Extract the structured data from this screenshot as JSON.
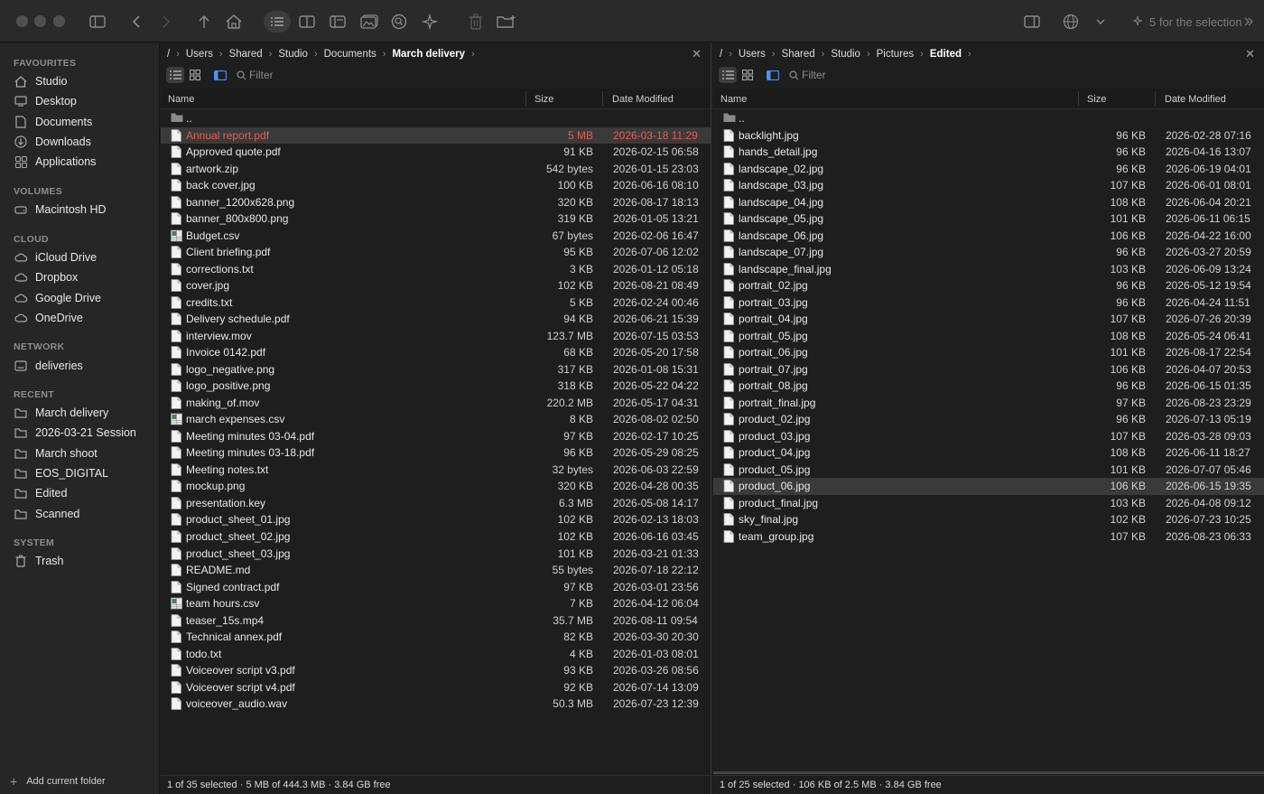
{
  "titlebar": {
    "selection_label": "5 for the selection"
  },
  "sidebar": {
    "favourites_head": "FAVOURITES",
    "favourites": [
      {
        "label": "Studio",
        "icon": "home-icon"
      },
      {
        "label": "Desktop",
        "icon": "desktop-icon"
      },
      {
        "label": "Documents",
        "icon": "document-icon"
      },
      {
        "label": "Downloads",
        "icon": "download-icon"
      },
      {
        "label": "Applications",
        "icon": "apps-icon"
      }
    ],
    "volumes_head": "VOLUMES",
    "volumes": [
      {
        "label": "Macintosh HD",
        "icon": "drive-icon"
      }
    ],
    "cloud_head": "CLOUD",
    "cloud": [
      {
        "label": "iCloud Drive",
        "icon": "cloud-icon"
      },
      {
        "label": "Dropbox",
        "icon": "cloud-icon"
      },
      {
        "label": "Google Drive",
        "icon": "cloud-icon"
      },
      {
        "label": "OneDrive",
        "icon": "cloud-icon"
      }
    ],
    "network_head": "NETWORK",
    "network": [
      {
        "label": "deliveries",
        "icon": "network-drive-icon"
      }
    ],
    "recent_head": "RECENT",
    "recent": [
      {
        "label": "March delivery",
        "icon": "folder-icon"
      },
      {
        "label": "2026-03-21 Session",
        "icon": "folder-icon"
      },
      {
        "label": "March shoot",
        "icon": "folder-icon"
      },
      {
        "label": "EOS_DIGITAL",
        "icon": "folder-icon"
      },
      {
        "label": "Edited",
        "icon": "folder-icon"
      },
      {
        "label": "Scanned",
        "icon": "folder-icon"
      }
    ],
    "system_head": "SYSTEM",
    "system": [
      {
        "label": "Trash",
        "icon": "trash-icon"
      }
    ],
    "add_folder": "Add current folder"
  },
  "left_pane": {
    "breadcrumb": [
      "/",
      "Users",
      "Shared",
      "Studio",
      "Documents",
      "March delivery"
    ],
    "filter_placeholder": "Filter",
    "col_name": "Name",
    "col_size": "Size",
    "col_date": "Date Modified",
    "files": [
      {
        "name": "..",
        "size": "",
        "date": "",
        "type": "folder"
      },
      {
        "name": "Annual report.pdf",
        "size": "5 MB",
        "date": "2026-03-18 11:29",
        "type": "doc",
        "selected": true,
        "highlight": true
      },
      {
        "name": "Approved quote.pdf",
        "size": "91 KB",
        "date": "2026-02-15 06:58",
        "type": "doc"
      },
      {
        "name": "artwork.zip",
        "size": "542 bytes",
        "date": "2026-01-15 23:03",
        "type": "doc"
      },
      {
        "name": "back cover.jpg",
        "size": "100 KB",
        "date": "2026-06-16 08:10",
        "type": "doc"
      },
      {
        "name": "banner_1200x628.png",
        "size": "320 KB",
        "date": "2026-08-17 18:13",
        "type": "doc"
      },
      {
        "name": "banner_800x800.png",
        "size": "319 KB",
        "date": "2026-01-05 13:21",
        "type": "doc"
      },
      {
        "name": "Budget.csv",
        "size": "67 bytes",
        "date": "2026-02-06 16:47",
        "type": "sheet"
      },
      {
        "name": "Client briefing.pdf",
        "size": "95 KB",
        "date": "2026-07-06 12:02",
        "type": "doc"
      },
      {
        "name": "corrections.txt",
        "size": "3 KB",
        "date": "2026-01-12 05:18",
        "type": "doc"
      },
      {
        "name": "cover.jpg",
        "size": "102 KB",
        "date": "2026-08-21 08:49",
        "type": "doc"
      },
      {
        "name": "credits.txt",
        "size": "5 KB",
        "date": "2026-02-24 00:46",
        "type": "doc"
      },
      {
        "name": "Delivery schedule.pdf",
        "size": "94 KB",
        "date": "2026-06-21 15:39",
        "type": "doc"
      },
      {
        "name": "interview.mov",
        "size": "123.7 MB",
        "date": "2026-07-15 03:53",
        "type": "doc"
      },
      {
        "name": "Invoice 0142.pdf",
        "size": "68 KB",
        "date": "2026-05-20 17:58",
        "type": "doc"
      },
      {
        "name": "logo_negative.png",
        "size": "317 KB",
        "date": "2026-01-08 15:31",
        "type": "doc"
      },
      {
        "name": "logo_positive.png",
        "size": "318 KB",
        "date": "2026-05-22 04:22",
        "type": "doc"
      },
      {
        "name": "making_of.mov",
        "size": "220.2 MB",
        "date": "2026-05-17 04:31",
        "type": "doc"
      },
      {
        "name": "march expenses.csv",
        "size": "8 KB",
        "date": "2026-08-02 02:50",
        "type": "sheet"
      },
      {
        "name": "Meeting minutes 03-04.pdf",
        "size": "97 KB",
        "date": "2026-02-17 10:25",
        "type": "doc"
      },
      {
        "name": "Meeting minutes 03-18.pdf",
        "size": "96 KB",
        "date": "2026-05-29 08:25",
        "type": "doc"
      },
      {
        "name": "Meeting notes.txt",
        "size": "32 bytes",
        "date": "2026-06-03 22:59",
        "type": "doc"
      },
      {
        "name": "mockup.png",
        "size": "320 KB",
        "date": "2026-04-28 00:35",
        "type": "doc"
      },
      {
        "name": "presentation.key",
        "size": "6.3 MB",
        "date": "2026-05-08 14:17",
        "type": "doc"
      },
      {
        "name": "product_sheet_01.jpg",
        "size": "102 KB",
        "date": "2026-02-13 18:03",
        "type": "doc"
      },
      {
        "name": "product_sheet_02.jpg",
        "size": "102 KB",
        "date": "2026-06-16 03:45",
        "type": "doc"
      },
      {
        "name": "product_sheet_03.jpg",
        "size": "101 KB",
        "date": "2026-03-21 01:33",
        "type": "doc"
      },
      {
        "name": "README.md",
        "size": "55 bytes",
        "date": "2026-07-18 22:12",
        "type": "doc"
      },
      {
        "name": "Signed contract.pdf",
        "size": "97 KB",
        "date": "2026-03-01 23:56",
        "type": "doc"
      },
      {
        "name": "team hours.csv",
        "size": "7 KB",
        "date": "2026-04-12 06:04",
        "type": "sheet"
      },
      {
        "name": "teaser_15s.mp4",
        "size": "35.7 MB",
        "date": "2026-08-11 09:54",
        "type": "doc"
      },
      {
        "name": "Technical annex.pdf",
        "size": "82 KB",
        "date": "2026-03-30 20:30",
        "type": "doc"
      },
      {
        "name": "todo.txt",
        "size": "4 KB",
        "date": "2026-01-03 08:01",
        "type": "doc"
      },
      {
        "name": "Voiceover script v3.pdf",
        "size": "93 KB",
        "date": "2026-03-26 08:56",
        "type": "doc"
      },
      {
        "name": "Voiceover script v4.pdf",
        "size": "92 KB",
        "date": "2026-07-14 13:09",
        "type": "doc"
      },
      {
        "name": "voiceover_audio.wav",
        "size": "50.3 MB",
        "date": "2026-07-23 12:39",
        "type": "doc"
      }
    ],
    "status": "1 of 35 selected · 5 MB of 444.3 MB · 3.84 GB free"
  },
  "right_pane": {
    "breadcrumb": [
      "/",
      "Users",
      "Shared",
      "Studio",
      "Pictures",
      "Edited"
    ],
    "filter_placeholder": "Filter",
    "col_name": "Name",
    "col_size": "Size",
    "col_date": "Date Modified",
    "files": [
      {
        "name": "..",
        "size": "",
        "date": "",
        "type": "folder"
      },
      {
        "name": "backlight.jpg",
        "size": "96 KB",
        "date": "2026-02-28 07:16",
        "type": "doc"
      },
      {
        "name": "hands_detail.jpg",
        "size": "96 KB",
        "date": "2026-04-16 13:07",
        "type": "doc"
      },
      {
        "name": "landscape_02.jpg",
        "size": "96 KB",
        "date": "2026-06-19 04:01",
        "type": "doc"
      },
      {
        "name": "landscape_03.jpg",
        "size": "107 KB",
        "date": "2026-06-01 08:01",
        "type": "doc"
      },
      {
        "name": "landscape_04.jpg",
        "size": "108 KB",
        "date": "2026-06-04 20:21",
        "type": "doc"
      },
      {
        "name": "landscape_05.jpg",
        "size": "101 KB",
        "date": "2026-06-11 06:15",
        "type": "doc"
      },
      {
        "name": "landscape_06.jpg",
        "size": "106 KB",
        "date": "2026-04-22 16:00",
        "type": "doc"
      },
      {
        "name": "landscape_07.jpg",
        "size": "96 KB",
        "date": "2026-03-27 20:59",
        "type": "doc"
      },
      {
        "name": "landscape_final.jpg",
        "size": "103 KB",
        "date": "2026-06-09 13:24",
        "type": "doc"
      },
      {
        "name": "portrait_02.jpg",
        "size": "96 KB",
        "date": "2026-05-12 19:54",
        "type": "doc"
      },
      {
        "name": "portrait_03.jpg",
        "size": "96 KB",
        "date": "2026-04-24 11:51",
        "type": "doc"
      },
      {
        "name": "portrait_04.jpg",
        "size": "107 KB",
        "date": "2026-07-26 20:39",
        "type": "doc"
      },
      {
        "name": "portrait_05.jpg",
        "size": "108 KB",
        "date": "2026-05-24 06:41",
        "type": "doc"
      },
      {
        "name": "portrait_06.jpg",
        "size": "101 KB",
        "date": "2026-08-17 22:54",
        "type": "doc"
      },
      {
        "name": "portrait_07.jpg",
        "size": "106 KB",
        "date": "2026-04-07 20:53",
        "type": "doc"
      },
      {
        "name": "portrait_08.jpg",
        "size": "96 KB",
        "date": "2026-06-15 01:35",
        "type": "doc"
      },
      {
        "name": "portrait_final.jpg",
        "size": "97 KB",
        "date": "2026-08-23 23:29",
        "type": "doc"
      },
      {
        "name": "product_02.jpg",
        "size": "96 KB",
        "date": "2026-07-13 05:19",
        "type": "doc"
      },
      {
        "name": "product_03.jpg",
        "size": "107 KB",
        "date": "2026-03-28 09:03",
        "type": "doc"
      },
      {
        "name": "product_04.jpg",
        "size": "108 KB",
        "date": "2026-06-11 18:27",
        "type": "doc"
      },
      {
        "name": "product_05.jpg",
        "size": "101 KB",
        "date": "2026-07-07 05:46",
        "type": "doc"
      },
      {
        "name": "product_06.jpg",
        "size": "106 KB",
        "date": "2026-06-15 19:35",
        "type": "doc",
        "selected": true
      },
      {
        "name": "product_final.jpg",
        "size": "103 KB",
        "date": "2026-04-08 09:12",
        "type": "doc"
      },
      {
        "name": "sky_final.jpg",
        "size": "102 KB",
        "date": "2026-07-23 10:25",
        "type": "doc"
      },
      {
        "name": "team_group.jpg",
        "size": "107 KB",
        "date": "2026-08-23 06:33",
        "type": "doc"
      }
    ],
    "status": "1 of 25 selected · 106 KB of 2.5 MB · 3.84 GB free"
  },
  "colors": {
    "highlight_text": "#e85a4f",
    "selection_bg": "#3a3a3a",
    "accent_blue": "#4f8ff7"
  }
}
